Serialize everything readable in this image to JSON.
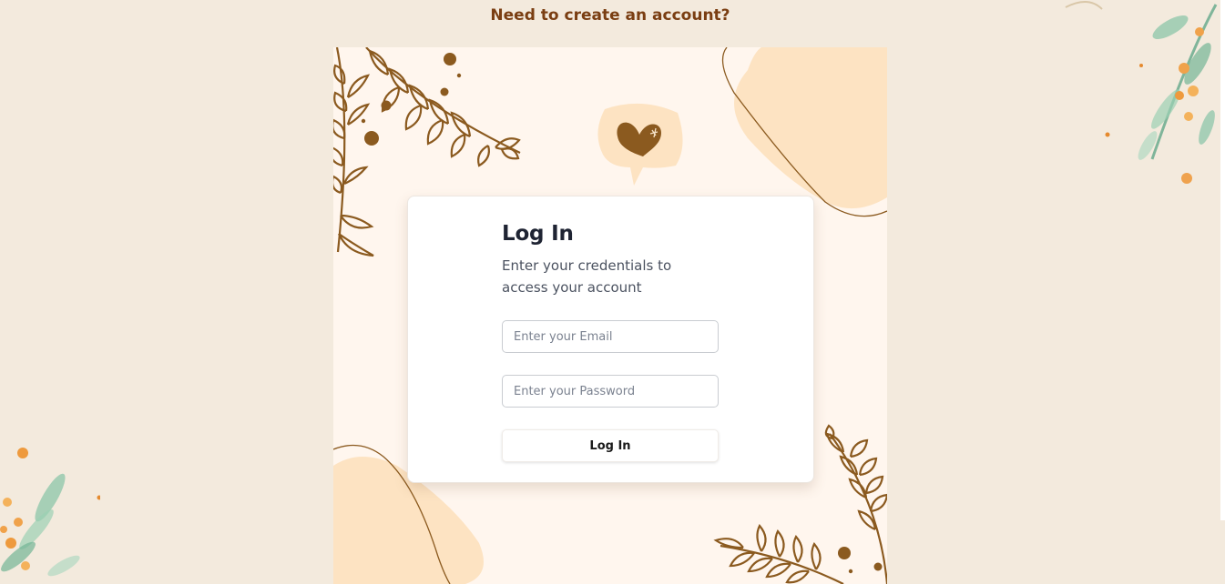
{
  "header": {
    "signup_prompt": "Need to create an account?"
  },
  "login": {
    "title": "Log In",
    "subtitle": "Enter your credentials to access your account",
    "email_placeholder": "Enter your Email",
    "email_value": "",
    "password_placeholder": "Enter your Password",
    "password_value": "",
    "submit_label": "Log In"
  },
  "colors": {
    "page_background": "#F3EADD",
    "panel_background": "#FFF6EE",
    "accent_brown": "#8B5A1F",
    "blob_peach": "#FDE3C2",
    "heading_text": "#1F2433",
    "link_text": "#7A3E12"
  },
  "icons": {
    "heart_bubble": "heart-speech-bubble-icon",
    "branch": "leafy-branch-decoration",
    "floral_corner": "watercolor-floral-corner"
  }
}
